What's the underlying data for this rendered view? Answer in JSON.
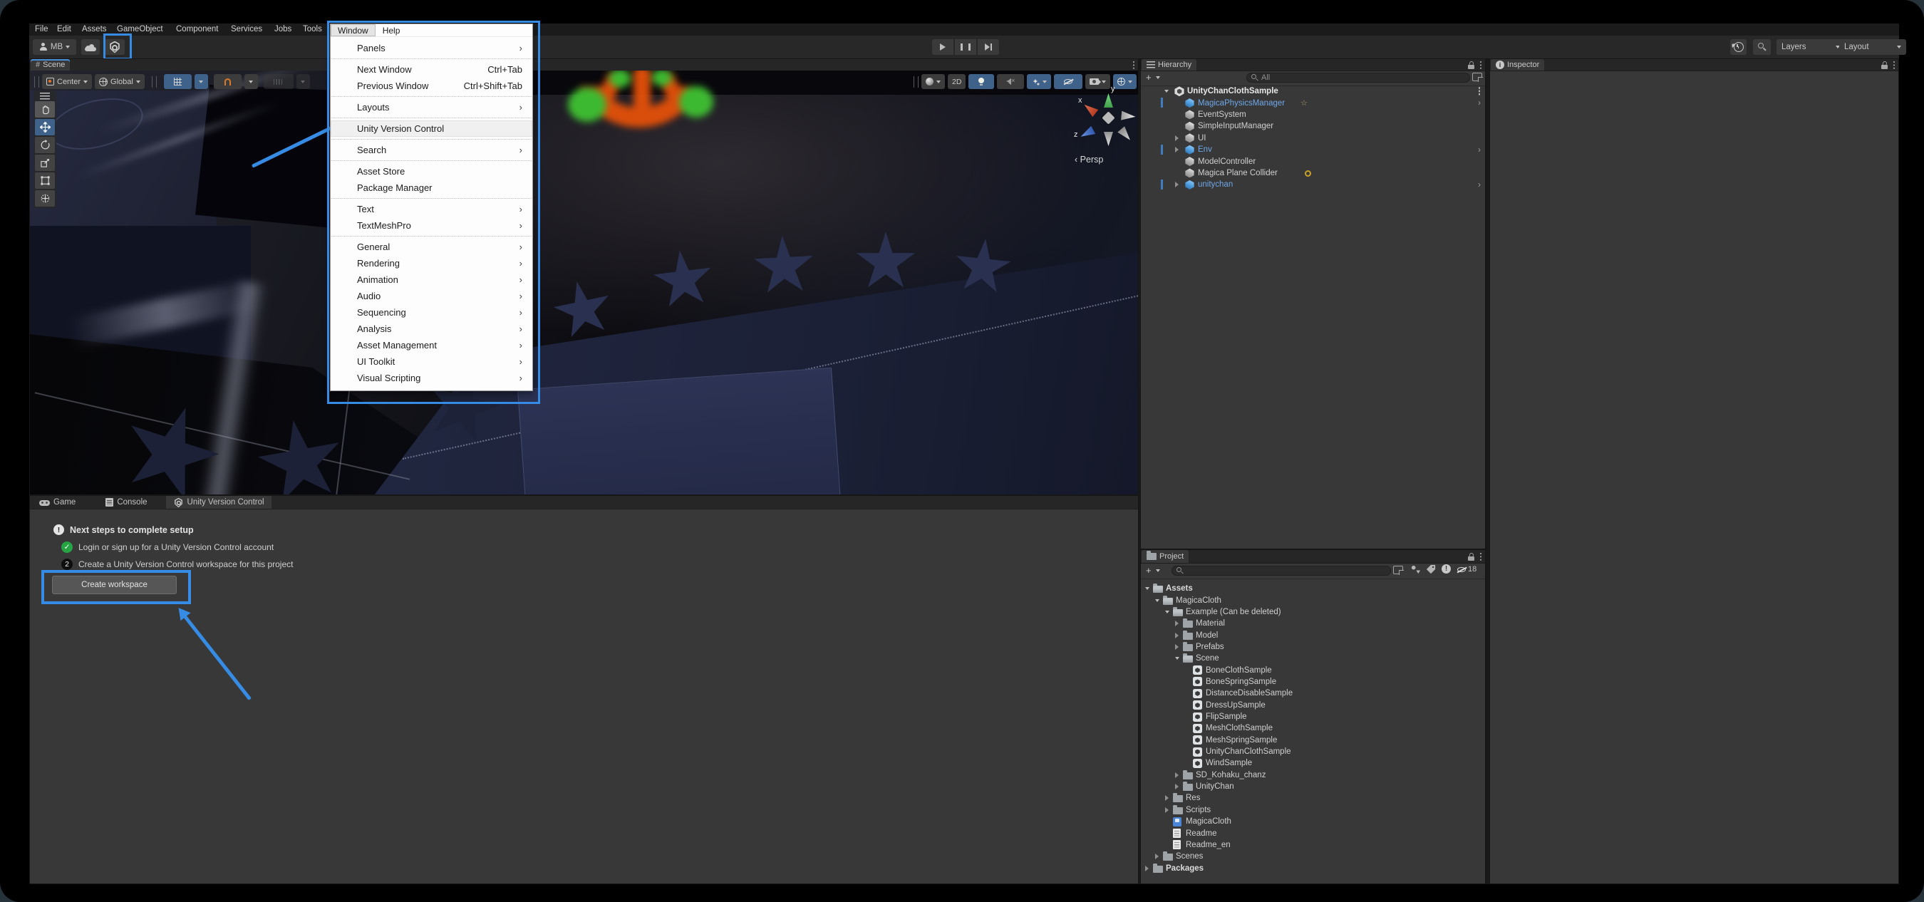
{
  "colors": {
    "annotation_blue": "#368ce4",
    "prefab_blue": "#6fa8e8",
    "active_button_blue": "#3e628a",
    "check_green": "#26a343"
  },
  "icons": {
    "plus": "+",
    "submenu_arrow": "›",
    "chevron": "›",
    "check": "✓",
    "warn": "!",
    "step2": "2",
    "persp_caret": "‹"
  },
  "menubar": {
    "items": [
      "File",
      "Edit",
      "Assets",
      "GameObject",
      "Component",
      "Services",
      "Jobs",
      "Tools"
    ]
  },
  "topbar": {
    "account_label": "MB",
    "layers_label": "Layers",
    "layout_label": "Layout"
  },
  "window_menu": {
    "menubar_label": "Window",
    "help_label": "Help",
    "groups": [
      [
        {
          "label": "Panels",
          "submenu": true
        }
      ],
      [
        {
          "label": "Next Window",
          "shortcut": "Ctrl+Tab"
        },
        {
          "label": "Previous Window",
          "shortcut": "Ctrl+Shift+Tab"
        }
      ],
      [
        {
          "label": "Layouts",
          "submenu": true
        }
      ],
      [
        {
          "label": "Unity Version Control",
          "highlight": true
        }
      ],
      [
        {
          "label": "Search",
          "submenu": true
        }
      ],
      [
        {
          "label": "Asset Store"
        },
        {
          "label": "Package Manager"
        }
      ],
      [
        {
          "label": "Text",
          "submenu": true
        },
        {
          "label": "TextMeshPro",
          "submenu": true
        }
      ],
      [
        {
          "label": "General",
          "submenu": true
        },
        {
          "label": "Rendering",
          "submenu": true
        },
        {
          "label": "Animation",
          "submenu": true
        },
        {
          "label": "Audio",
          "submenu": true
        },
        {
          "label": "Sequencing",
          "submenu": true
        },
        {
          "label": "Analysis",
          "submenu": true
        },
        {
          "label": "Asset Management",
          "submenu": true
        },
        {
          "label": "UI Toolkit",
          "submenu": true
        },
        {
          "label": "Visual Scripting",
          "submenu": true
        }
      ]
    ]
  },
  "scene": {
    "tab_label": "Scene",
    "persp_label": "Persp",
    "axis": {
      "x": "x",
      "y": "y",
      "z": "z"
    },
    "overlay": {
      "pivot": "Center",
      "orientation": "Global",
      "two_d": "2D"
    }
  },
  "hierarchy": {
    "tab_label": "Hierarchy",
    "search_placeholder": "All",
    "items": [
      {
        "label": "UnityChanClothSample",
        "depth": 0,
        "icon": "scene-root",
        "arrow": "open",
        "root": true,
        "kebab": true
      },
      {
        "label": "MagicaPhysicsManager",
        "depth": 1,
        "icon": "cube-blue",
        "stripe": true,
        "star": true,
        "chevron": true,
        "blue": true
      },
      {
        "label": "EventSystem",
        "depth": 1,
        "icon": "cube"
      },
      {
        "label": "SimpleInputManager",
        "depth": 1,
        "icon": "cube"
      },
      {
        "label": "UI",
        "depth": 1,
        "icon": "cube",
        "arrow": "closed"
      },
      {
        "label": "Env",
        "depth": 1,
        "icon": "cube-blue",
        "arrow": "closed",
        "stripe": true,
        "chevron": true,
        "blue": true
      },
      {
        "label": "ModelController",
        "depth": 1,
        "icon": "cube"
      },
      {
        "label": "Magica Plane Collider",
        "depth": 1,
        "icon": "cube",
        "olive_badge": true
      },
      {
        "label": "unitychan",
        "depth": 1,
        "icon": "cube-blue",
        "arrow": "closed",
        "stripe": true,
        "chevron": true,
        "blue": true
      }
    ]
  },
  "project": {
    "tab_label": "Project",
    "hidden_count": "18",
    "items": [
      {
        "label": "Assets",
        "depth": 0,
        "icon": "folder-open",
        "arrow": "open",
        "bold": true
      },
      {
        "label": "MagicaCloth",
        "depth": 1,
        "icon": "folder-open",
        "arrow": "open"
      },
      {
        "label": "Example (Can be deleted)",
        "depth": 2,
        "icon": "folder-open",
        "arrow": "open"
      },
      {
        "label": "Material",
        "depth": 3,
        "icon": "folder",
        "arrow": "closed"
      },
      {
        "label": "Model",
        "depth": 3,
        "icon": "folder",
        "arrow": "closed"
      },
      {
        "label": "Prefabs",
        "depth": 3,
        "icon": "folder",
        "arrow": "closed"
      },
      {
        "label": "Scene",
        "depth": 3,
        "icon": "folder-open",
        "arrow": "open"
      },
      {
        "label": "BoneClothSample",
        "depth": 4,
        "icon": "scene"
      },
      {
        "label": "BoneSpringSample",
        "depth": 4,
        "icon": "scene"
      },
      {
        "label": "DistanceDisableSample",
        "depth": 4,
        "icon": "scene"
      },
      {
        "label": "DressUpSample",
        "depth": 4,
        "icon": "scene"
      },
      {
        "label": "FlipSample",
        "depth": 4,
        "icon": "scene"
      },
      {
        "label": "MeshClothSample",
        "depth": 4,
        "icon": "scene"
      },
      {
        "label": "MeshSpringSample",
        "depth": 4,
        "icon": "scene"
      },
      {
        "label": "UnityChanClothSample",
        "depth": 4,
        "icon": "scene"
      },
      {
        "label": "WindSample",
        "depth": 4,
        "icon": "scene"
      },
      {
        "label": "SD_Kohaku_chanz",
        "depth": 3,
        "icon": "folder",
        "arrow": "closed"
      },
      {
        "label": "UnityChan",
        "depth": 3,
        "icon": "folder",
        "arrow": "closed"
      },
      {
        "label": "Res",
        "depth": 2,
        "icon": "folder",
        "arrow": "closed"
      },
      {
        "label": "Scripts",
        "depth": 2,
        "icon": "folder",
        "arrow": "closed"
      },
      {
        "label": "MagicaCloth",
        "depth": 2,
        "icon": "package"
      },
      {
        "label": "Readme",
        "depth": 2,
        "icon": "doc"
      },
      {
        "label": "Readme_en",
        "depth": 2,
        "icon": "doc"
      },
      {
        "label": "Scenes",
        "depth": 1,
        "icon": "folder",
        "arrow": "closed"
      },
      {
        "label": "Packages",
        "depth": 0,
        "icon": "folder",
        "arrow": "closed",
        "bold": true
      }
    ]
  },
  "inspector": {
    "tab_label": "Inspector"
  },
  "bottom": {
    "tabs": [
      {
        "label": "Game",
        "icon": "gamepad"
      },
      {
        "label": "Console",
        "icon": "console"
      },
      {
        "label": "Unity Version Control",
        "icon": "shield",
        "active": true
      }
    ],
    "setup": {
      "title": "Next steps to complete setup",
      "steps": [
        {
          "glyph": "✓",
          "kind": "green",
          "label": "Login or sign up for a Unity Version Control account"
        },
        {
          "glyph": "2",
          "kind": "black",
          "label": "Create a Unity Version Control workspace for this project"
        }
      ],
      "button_label": "Create workspace"
    }
  }
}
